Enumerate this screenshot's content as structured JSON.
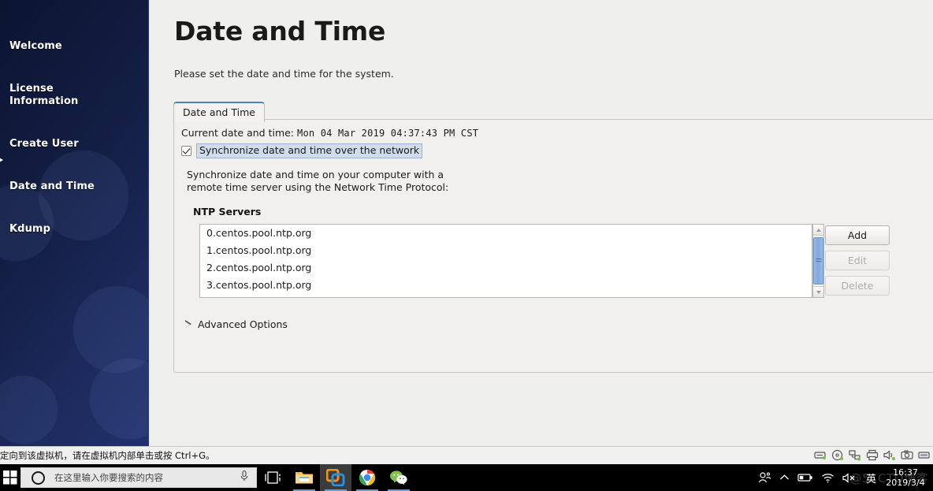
{
  "sidebar": {
    "items": [
      {
        "label": "Welcome",
        "current": false
      },
      {
        "label": "License\nInformation",
        "current": false
      },
      {
        "label": "Create User",
        "current": false
      },
      {
        "label": "Date and Time",
        "current": true
      },
      {
        "label": "Kdump",
        "current": false
      }
    ]
  },
  "main": {
    "title": "Date and Time",
    "subtitle": "Please set the date and time for the system.",
    "tab_label": "Date and Time",
    "current_datetime_label": "Current date and time:",
    "current_datetime_value": "Mon 04 Mar 2019 04:37:43 PM CST",
    "sync_checkbox_label": "Synchronize date and time over the network",
    "sync_checkbox_checked": true,
    "sync_description_line1": "Synchronize date and time on your computer with a",
    "sync_description_line2": "remote time server using the Network Time Protocol:",
    "ntp_heading": "NTP Servers",
    "ntp_servers": [
      "0.centos.pool.ntp.org",
      "1.centos.pool.ntp.org",
      "2.centos.pool.ntp.org",
      "3.centos.pool.ntp.org"
    ],
    "buttons": {
      "add": "Add",
      "edit": "Edit",
      "delete": "Delete"
    },
    "advanced_options": "Advanced Options",
    "accent_color": "#4a82c4",
    "focus_highlight_color": "#cfdcec"
  },
  "vm_status": {
    "hint": "\\定向到该虚拟机，请在虚拟机内部单击或按 Ctrl+G。",
    "devices": [
      "hard-disk-icon",
      "cd-dvd-icon",
      "network-icon",
      "printer-icon",
      "sound-icon",
      "camera-icon",
      "usb-icon"
    ]
  },
  "taskbar": {
    "search_placeholder": "在这里输入你要搜索的内容",
    "apps": [
      {
        "name": "task-view",
        "active": false,
        "running": false
      },
      {
        "name": "file-explorer",
        "active": false,
        "running": true
      },
      {
        "name": "vmware-workstation",
        "active": true,
        "running": true
      },
      {
        "name": "google-chrome",
        "active": false,
        "running": true
      },
      {
        "name": "wechat",
        "active": false,
        "running": true
      }
    ],
    "tray": {
      "ime": "英",
      "time": "16:37",
      "date": "2019/3/4"
    },
    "watermark": "@51CTO博客"
  }
}
